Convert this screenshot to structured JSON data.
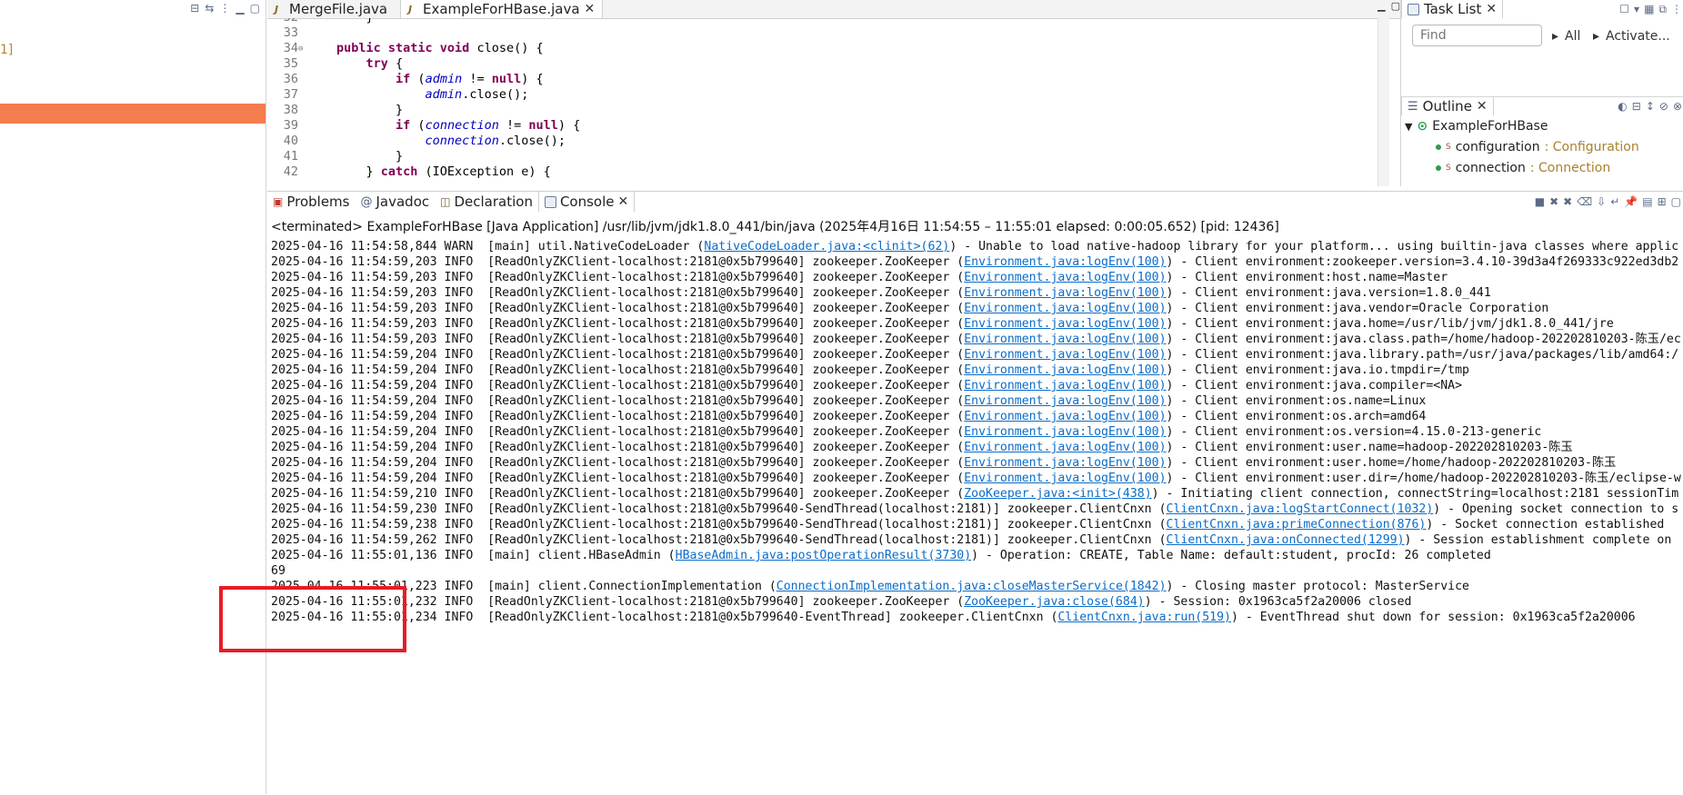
{
  "left": {
    "fragment": "1]",
    "toolbar_icons": [
      "collapse-all-icon",
      "link-editor-icon",
      "view-menu-icon",
      "minimize-icon",
      "maximize-icon"
    ]
  },
  "editor": {
    "tabs": [
      {
        "label": "MergeFile.java",
        "active": false
      },
      {
        "label": "ExampleForHBase.java",
        "active": true
      }
    ],
    "lines": [
      {
        "n": "32",
        "segs": [
          {
            "t": "    }",
            "c": ""
          }
        ]
      },
      {
        "n": "33",
        "segs": []
      },
      {
        "n": "34",
        "fold": "⊖",
        "segs": [
          {
            "t": "public static void ",
            "c": "kw"
          },
          {
            "t": "close() {",
            "c": ""
          }
        ]
      },
      {
        "n": "35",
        "segs": [
          {
            "t": "    ",
            "c": ""
          },
          {
            "t": "try",
            "c": "kw"
          },
          {
            "t": " {",
            "c": ""
          }
        ]
      },
      {
        "n": "36",
        "segs": [
          {
            "t": "        ",
            "c": ""
          },
          {
            "t": "if",
            "c": "kw"
          },
          {
            "t": " (",
            "c": ""
          },
          {
            "t": "admin",
            "c": "fld"
          },
          {
            "t": " != ",
            "c": ""
          },
          {
            "t": "null",
            "c": "kw"
          },
          {
            "t": ") {",
            "c": ""
          }
        ]
      },
      {
        "n": "37",
        "segs": [
          {
            "t": "            ",
            "c": ""
          },
          {
            "t": "admin",
            "c": "fld"
          },
          {
            "t": ".close();",
            "c": ""
          }
        ]
      },
      {
        "n": "38",
        "segs": [
          {
            "t": "        }",
            "c": ""
          }
        ]
      },
      {
        "n": "39",
        "segs": [
          {
            "t": "        ",
            "c": ""
          },
          {
            "t": "if",
            "c": "kw"
          },
          {
            "t": " (",
            "c": ""
          },
          {
            "t": "connection",
            "c": "fld"
          },
          {
            "t": " != ",
            "c": ""
          },
          {
            "t": "null",
            "c": "kw"
          },
          {
            "t": ") {",
            "c": ""
          }
        ]
      },
      {
        "n": "40",
        "segs": [
          {
            "t": "            ",
            "c": ""
          },
          {
            "t": "connection",
            "c": "fld"
          },
          {
            "t": ".close();",
            "c": ""
          }
        ]
      },
      {
        "n": "41",
        "segs": [
          {
            "t": "        }",
            "c": ""
          }
        ]
      },
      {
        "n": "42",
        "segs": [
          {
            "t": "    } ",
            "c": ""
          },
          {
            "t": "catch",
            "c": "kw"
          },
          {
            "t": " (IOException e) {",
            "c": ""
          }
        ]
      }
    ]
  },
  "tasklist": {
    "title": "Task List",
    "find_placeholder": "Find",
    "all_label": "All",
    "activate_label": "Activate..."
  },
  "outline": {
    "title": "Outline",
    "root": "ExampleForHBase",
    "items": [
      {
        "name": "configuration",
        "type": " : Configuration"
      },
      {
        "name": "connection",
        "type": " : Connection"
      }
    ]
  },
  "console": {
    "tabs": [
      {
        "label": "Problems",
        "icon": "problems-icon"
      },
      {
        "label": "Javadoc",
        "icon": "at-icon"
      },
      {
        "label": "Declaration",
        "icon": "declaration-icon"
      },
      {
        "label": "Console",
        "icon": "console-icon",
        "active": true
      }
    ],
    "terminated": "<terminated> ExampleForHBase [Java Application] /usr/lib/jvm/jdk1.8.0_441/bin/java  (2025年4月16日 11:54:55 – 11:55:01 elapsed: 0:00:05.652) [pid: 12436]",
    "lines": [
      {
        "pre": "2025-04-16 11:54:58,844 WARN  [main] util.NativeCodeLoader (",
        "link": "NativeCodeLoader.java:<clinit>(62)",
        "post": ") - Unable to load native-hadoop library for your platform... using builtin-java classes where applic"
      },
      {
        "pre": "2025-04-16 11:54:59,203 INFO  [ReadOnlyZKClient-localhost:2181@0x5b799640] zookeeper.ZooKeeper (",
        "link": "Environment.java:logEnv(100)",
        "post": ") - Client environment:zookeeper.version=3.4.10-39d3a4f269333c922ed3db2"
      },
      {
        "pre": "2025-04-16 11:54:59,203 INFO  [ReadOnlyZKClient-localhost:2181@0x5b799640] zookeeper.ZooKeeper (",
        "link": "Environment.java:logEnv(100)",
        "post": ") - Client environment:host.name=Master"
      },
      {
        "pre": "2025-04-16 11:54:59,203 INFO  [ReadOnlyZKClient-localhost:2181@0x5b799640] zookeeper.ZooKeeper (",
        "link": "Environment.java:logEnv(100)",
        "post": ") - Client environment:java.version=1.8.0_441"
      },
      {
        "pre": "2025-04-16 11:54:59,203 INFO  [ReadOnlyZKClient-localhost:2181@0x5b799640] zookeeper.ZooKeeper (",
        "link": "Environment.java:logEnv(100)",
        "post": ") - Client environment:java.vendor=Oracle Corporation"
      },
      {
        "pre": "2025-04-16 11:54:59,203 INFO  [ReadOnlyZKClient-localhost:2181@0x5b799640] zookeeper.ZooKeeper (",
        "link": "Environment.java:logEnv(100)",
        "post": ") - Client environment:java.home=/usr/lib/jvm/jdk1.8.0_441/jre"
      },
      {
        "pre": "2025-04-16 11:54:59,203 INFO  [ReadOnlyZKClient-localhost:2181@0x5b799640] zookeeper.ZooKeeper (",
        "link": "Environment.java:logEnv(100)",
        "post": ") - Client environment:java.class.path=/home/hadoop-202202810203-陈玉/ec"
      },
      {
        "pre": "2025-04-16 11:54:59,204 INFO  [ReadOnlyZKClient-localhost:2181@0x5b799640] zookeeper.ZooKeeper (",
        "link": "Environment.java:logEnv(100)",
        "post": ") - Client environment:java.library.path=/usr/java/packages/lib/amd64:/"
      },
      {
        "pre": "2025-04-16 11:54:59,204 INFO  [ReadOnlyZKClient-localhost:2181@0x5b799640] zookeeper.ZooKeeper (",
        "link": "Environment.java:logEnv(100)",
        "post": ") - Client environment:java.io.tmpdir=/tmp"
      },
      {
        "pre": "2025-04-16 11:54:59,204 INFO  [ReadOnlyZKClient-localhost:2181@0x5b799640] zookeeper.ZooKeeper (",
        "link": "Environment.java:logEnv(100)",
        "post": ") - Client environment:java.compiler=<NA>"
      },
      {
        "pre": "2025-04-16 11:54:59,204 INFO  [ReadOnlyZKClient-localhost:2181@0x5b799640] zookeeper.ZooKeeper (",
        "link": "Environment.java:logEnv(100)",
        "post": ") - Client environment:os.name=Linux"
      },
      {
        "pre": "2025-04-16 11:54:59,204 INFO  [ReadOnlyZKClient-localhost:2181@0x5b799640] zookeeper.ZooKeeper (",
        "link": "Environment.java:logEnv(100)",
        "post": ") - Client environment:os.arch=amd64"
      },
      {
        "pre": "2025-04-16 11:54:59,204 INFO  [ReadOnlyZKClient-localhost:2181@0x5b799640] zookeeper.ZooKeeper (",
        "link": "Environment.java:logEnv(100)",
        "post": ") - Client environment:os.version=4.15.0-213-generic"
      },
      {
        "pre": "2025-04-16 11:54:59,204 INFO  [ReadOnlyZKClient-localhost:2181@0x5b799640] zookeeper.ZooKeeper (",
        "link": "Environment.java:logEnv(100)",
        "post": ") - Client environment:user.name=hadoop-202202810203-陈玉"
      },
      {
        "pre": "2025-04-16 11:54:59,204 INFO  [ReadOnlyZKClient-localhost:2181@0x5b799640] zookeeper.ZooKeeper (",
        "link": "Environment.java:logEnv(100)",
        "post": ") - Client environment:user.home=/home/hadoop-202202810203-陈玉"
      },
      {
        "pre": "2025-04-16 11:54:59,204 INFO  [ReadOnlyZKClient-localhost:2181@0x5b799640] zookeeper.ZooKeeper (",
        "link": "Environment.java:logEnv(100)",
        "post": ") - Client environment:user.dir=/home/hadoop-202202810203-陈玉/eclipse-w"
      },
      {
        "pre": "2025-04-16 11:54:59,210 INFO  [ReadOnlyZKClient-localhost:2181@0x5b799640] zookeeper.ZooKeeper (",
        "link": "ZooKeeper.java:<init>(438)",
        "post": ") - Initiating client connection, connectString=localhost:2181 sessionTim"
      },
      {
        "pre": "2025-04-16 11:54:59,230 INFO  [ReadOnlyZKClient-localhost:2181@0x5b799640-SendThread(localhost:2181)] zookeeper.ClientCnxn (",
        "link": "ClientCnxn.java:logStartConnect(1032)",
        "post": ") - Opening socket connection to s"
      },
      {
        "pre": "2025-04-16 11:54:59,238 INFO  [ReadOnlyZKClient-localhost:2181@0x5b799640-SendThread(localhost:2181)] zookeeper.ClientCnxn (",
        "link": "ClientCnxn.java:primeConnection(876)",
        "post": ") - Socket connection established"
      },
      {
        "pre": "2025-04-16 11:54:59,262 INFO  [ReadOnlyZKClient-localhost:2181@0x5b799640-SendThread(localhost:2181)] zookeeper.ClientCnxn (",
        "link": "ClientCnxn.java:onConnected(1299)",
        "post": ") - Session establishment complete on"
      },
      {
        "pre": "2025-04-16 11:55:01,136 INFO  [main] client.HBaseAdmin (",
        "link": "HBaseAdmin.java:postOperationResult(3730)",
        "post": ") - Operation: CREATE, Table Name: default:student, procId: 26 completed"
      },
      {
        "pre": "69",
        "link": "",
        "post": ""
      },
      {
        "pre": "2025-04-16 11:55:01,223 INFO  [main] client.ConnectionImplementation (",
        "link": "ConnectionImplementation.java:closeMasterService(1842)",
        "post": ") - Closing master protocol: MasterService"
      },
      {
        "pre": "2025-04-16 11:55:01,232 INFO  [ReadOnlyZKClient-localhost:2181@0x5b799640] zookeeper.ZooKeeper (",
        "link": "ZooKeeper.java:close(684)",
        "post": ") - Session: 0x1963ca5f2a20006 closed"
      },
      {
        "pre": "2025-04-16 11:55:01,234 INFO  [ReadOnlyZKClient-localhost:2181@0x5b799640-EventThread] zookeeper.ClientCnxn (",
        "link": "ClientCnxn.java:run(519)",
        "post": ") - EventThread shut down for session: 0x1963ca5f2a20006"
      }
    ]
  },
  "colors": {
    "selection": "#f47c4d",
    "annotation": "#ea1b24",
    "link": "#0b6cc8",
    "keyword": "#7f0055",
    "field": "#0000c0"
  }
}
